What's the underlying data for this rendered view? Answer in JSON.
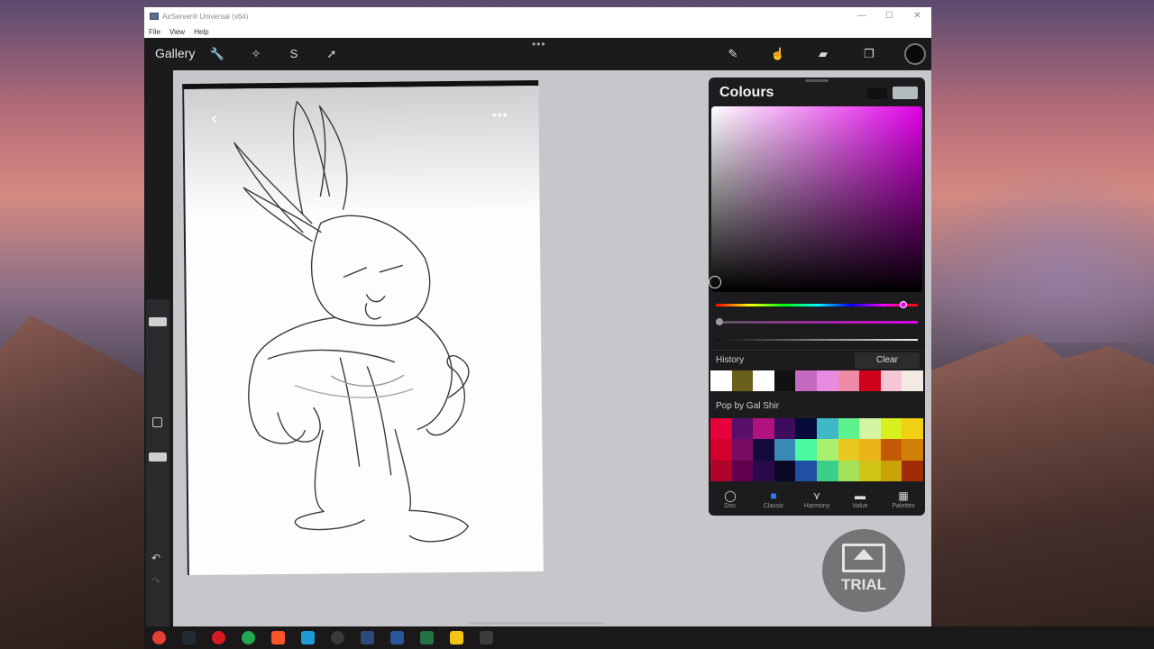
{
  "window": {
    "title": "AirServer® Universal (x64)",
    "menu": [
      "File",
      "View",
      "Help"
    ]
  },
  "toolbar": {
    "gallery_label": "Gallery",
    "left_icons": [
      "wrench-icon",
      "magic-wand-icon",
      "selection-s-icon",
      "arrow-cursor-icon"
    ],
    "right_icons": [
      "brush-icon",
      "smudge-icon",
      "eraser-icon",
      "layers-icon"
    ],
    "active_color": "#0a0a0a"
  },
  "colours_panel": {
    "title": "Colours",
    "hue_color": "#e000e8",
    "history_label": "History",
    "clear_label": "Clear",
    "history": [
      "#ffffff",
      "#6b5f1c",
      "#ffffff",
      "#111111",
      "#c46ac0",
      "#e88ae0",
      "#ee8aa6",
      "#d0021b",
      "#f6c6d4",
      "#f3ebe3"
    ],
    "palette_label": "Pop by Gal Shir",
    "palette": [
      "#e8003c",
      "#58106a",
      "#b0137e",
      "#3d0c5c",
      "#060b3a",
      "#3fb8c8",
      "#5ef28e",
      "#d6f5a4",
      "#d8f01e",
      "#f0d010",
      "#d3002e",
      "#7a0c64",
      "#120a3a",
      "#3a8ab8",
      "#4dfaa4",
      "#aaf070",
      "#e8c820",
      "#eab418",
      "#c45a06",
      "#d08006",
      "#b0052a",
      "#62004e",
      "#2a0a4a",
      "#0a0a26",
      "#2050a4",
      "#3ad08a",
      "#a4e25a",
      "#d0c416",
      "#c8a408",
      "#a02c06"
    ],
    "tabs": [
      {
        "label": "Disc",
        "icon": "disc-icon"
      },
      {
        "label": "Classic",
        "icon": "classic-square-icon"
      },
      {
        "label": "Harmony",
        "icon": "harmony-icon"
      },
      {
        "label": "Value",
        "icon": "value-sliders-icon"
      },
      {
        "label": "Palettes",
        "icon": "palettes-grid-icon"
      }
    ],
    "active_tab": "Classic"
  },
  "trial_badge": {
    "label": "TRIAL"
  },
  "taskbar": {
    "icons": [
      "chrome-icon",
      "terminal-icon",
      "opera-icon",
      "upwork-icon",
      "brave-icon",
      "app-blue-icon",
      "obs-icon",
      "app-dark-icon",
      "word-doc-icon",
      "excel-icon",
      "sticky-notes-icon",
      "window-app-icon"
    ]
  }
}
